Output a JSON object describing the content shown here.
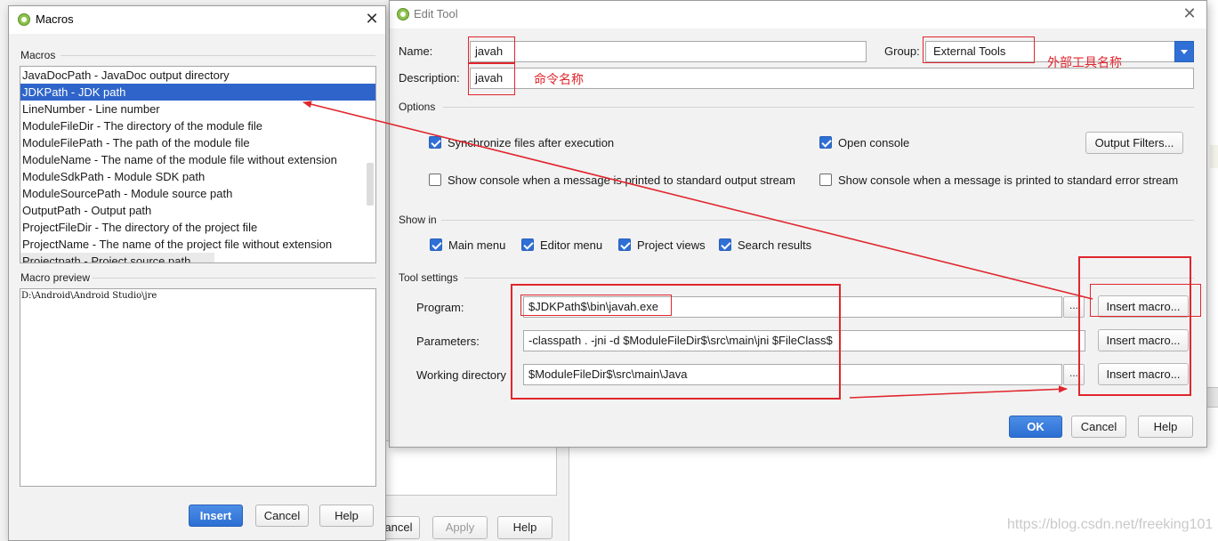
{
  "background_dialog": {
    "buttons": [
      {
        "label": "ancel",
        "enabled": true
      },
      {
        "label": "Apply",
        "enabled": false
      },
      {
        "label": "Help",
        "enabled": true
      }
    ]
  },
  "macros_dialog": {
    "title": "Macros",
    "macros_group_label": "Macros",
    "macros": [
      {
        "label": "JavaDocPath - JavaDoc output directory",
        "selected": false
      },
      {
        "label": "JDKPath - JDK path",
        "selected": true
      },
      {
        "label": "LineNumber - Line number",
        "selected": false
      },
      {
        "label": "ModuleFileDir - The directory of the module file",
        "selected": false
      },
      {
        "label": "ModuleFilePath - The path of the module file",
        "selected": false
      },
      {
        "label": "ModuleName - The name of the module file without extension",
        "selected": false
      },
      {
        "label": "ModuleSdkPath - Module SDK path",
        "selected": false
      },
      {
        "label": "ModuleSourcePath - Module source path",
        "selected": false
      },
      {
        "label": "OutputPath - Output path",
        "selected": false
      },
      {
        "label": "ProjectFileDir - The directory of the project file",
        "selected": false
      },
      {
        "label": "ProjectName - The name of the project file without extension",
        "selected": false
      },
      {
        "label": "Projectpath - Project source path",
        "selected": false
      }
    ],
    "preview_label": "Macro preview",
    "preview_text": "D:\\Android\\Android Studio\\jre",
    "buttons": {
      "insert": "Insert",
      "cancel": "Cancel",
      "help": "Help"
    }
  },
  "edit_tool": {
    "title": "Edit Tool",
    "name_label": "Name:",
    "name_value": "javah",
    "group_label": "Group:",
    "group_value": "External Tools",
    "description_label": "Description:",
    "description_value": "javah",
    "options_label": "Options",
    "options": {
      "sync_files": {
        "label": "Synchronize files after execution",
        "checked": true
      },
      "open_console": {
        "label": "Open console",
        "checked": true
      },
      "console_stdout": {
        "label": "Show console when a message is printed to standard output stream",
        "checked": false
      },
      "console_stderr": {
        "label": "Show console when a message is printed to standard error stream",
        "checked": false
      }
    },
    "output_filters_label": "Output Filters...",
    "show_in_label": "Show in",
    "show_in": {
      "main_menu": {
        "label": "Main menu",
        "checked": true
      },
      "editor_menu": {
        "label": "Editor menu",
        "checked": true
      },
      "project_views": {
        "label": "Project views",
        "checked": true
      },
      "search_results": {
        "label": "Search results",
        "checked": true
      }
    },
    "tool_settings_label": "Tool settings",
    "program_label": "Program:",
    "program_value": "$JDKPath$\\bin\\javah.exe",
    "parameters_label": "Parameters:",
    "parameters_value": "-classpath . -jni -d $ModuleFileDir$\\src\\main\\jni $FileClass$",
    "working_dir_label": "Working directory",
    "working_dir_value": "$ModuleFileDir$\\src\\main\\Java",
    "browse_label": "...",
    "insert_macro_label": "Insert macro...",
    "buttons": {
      "ok": "OK",
      "cancel": "Cancel",
      "help": "Help"
    }
  },
  "annotations": {
    "group_note": "外部工具名称",
    "description_note": "命令名称",
    "color": "#e0262d"
  },
  "watermark": "https://blog.csdn.net/freeking101"
}
